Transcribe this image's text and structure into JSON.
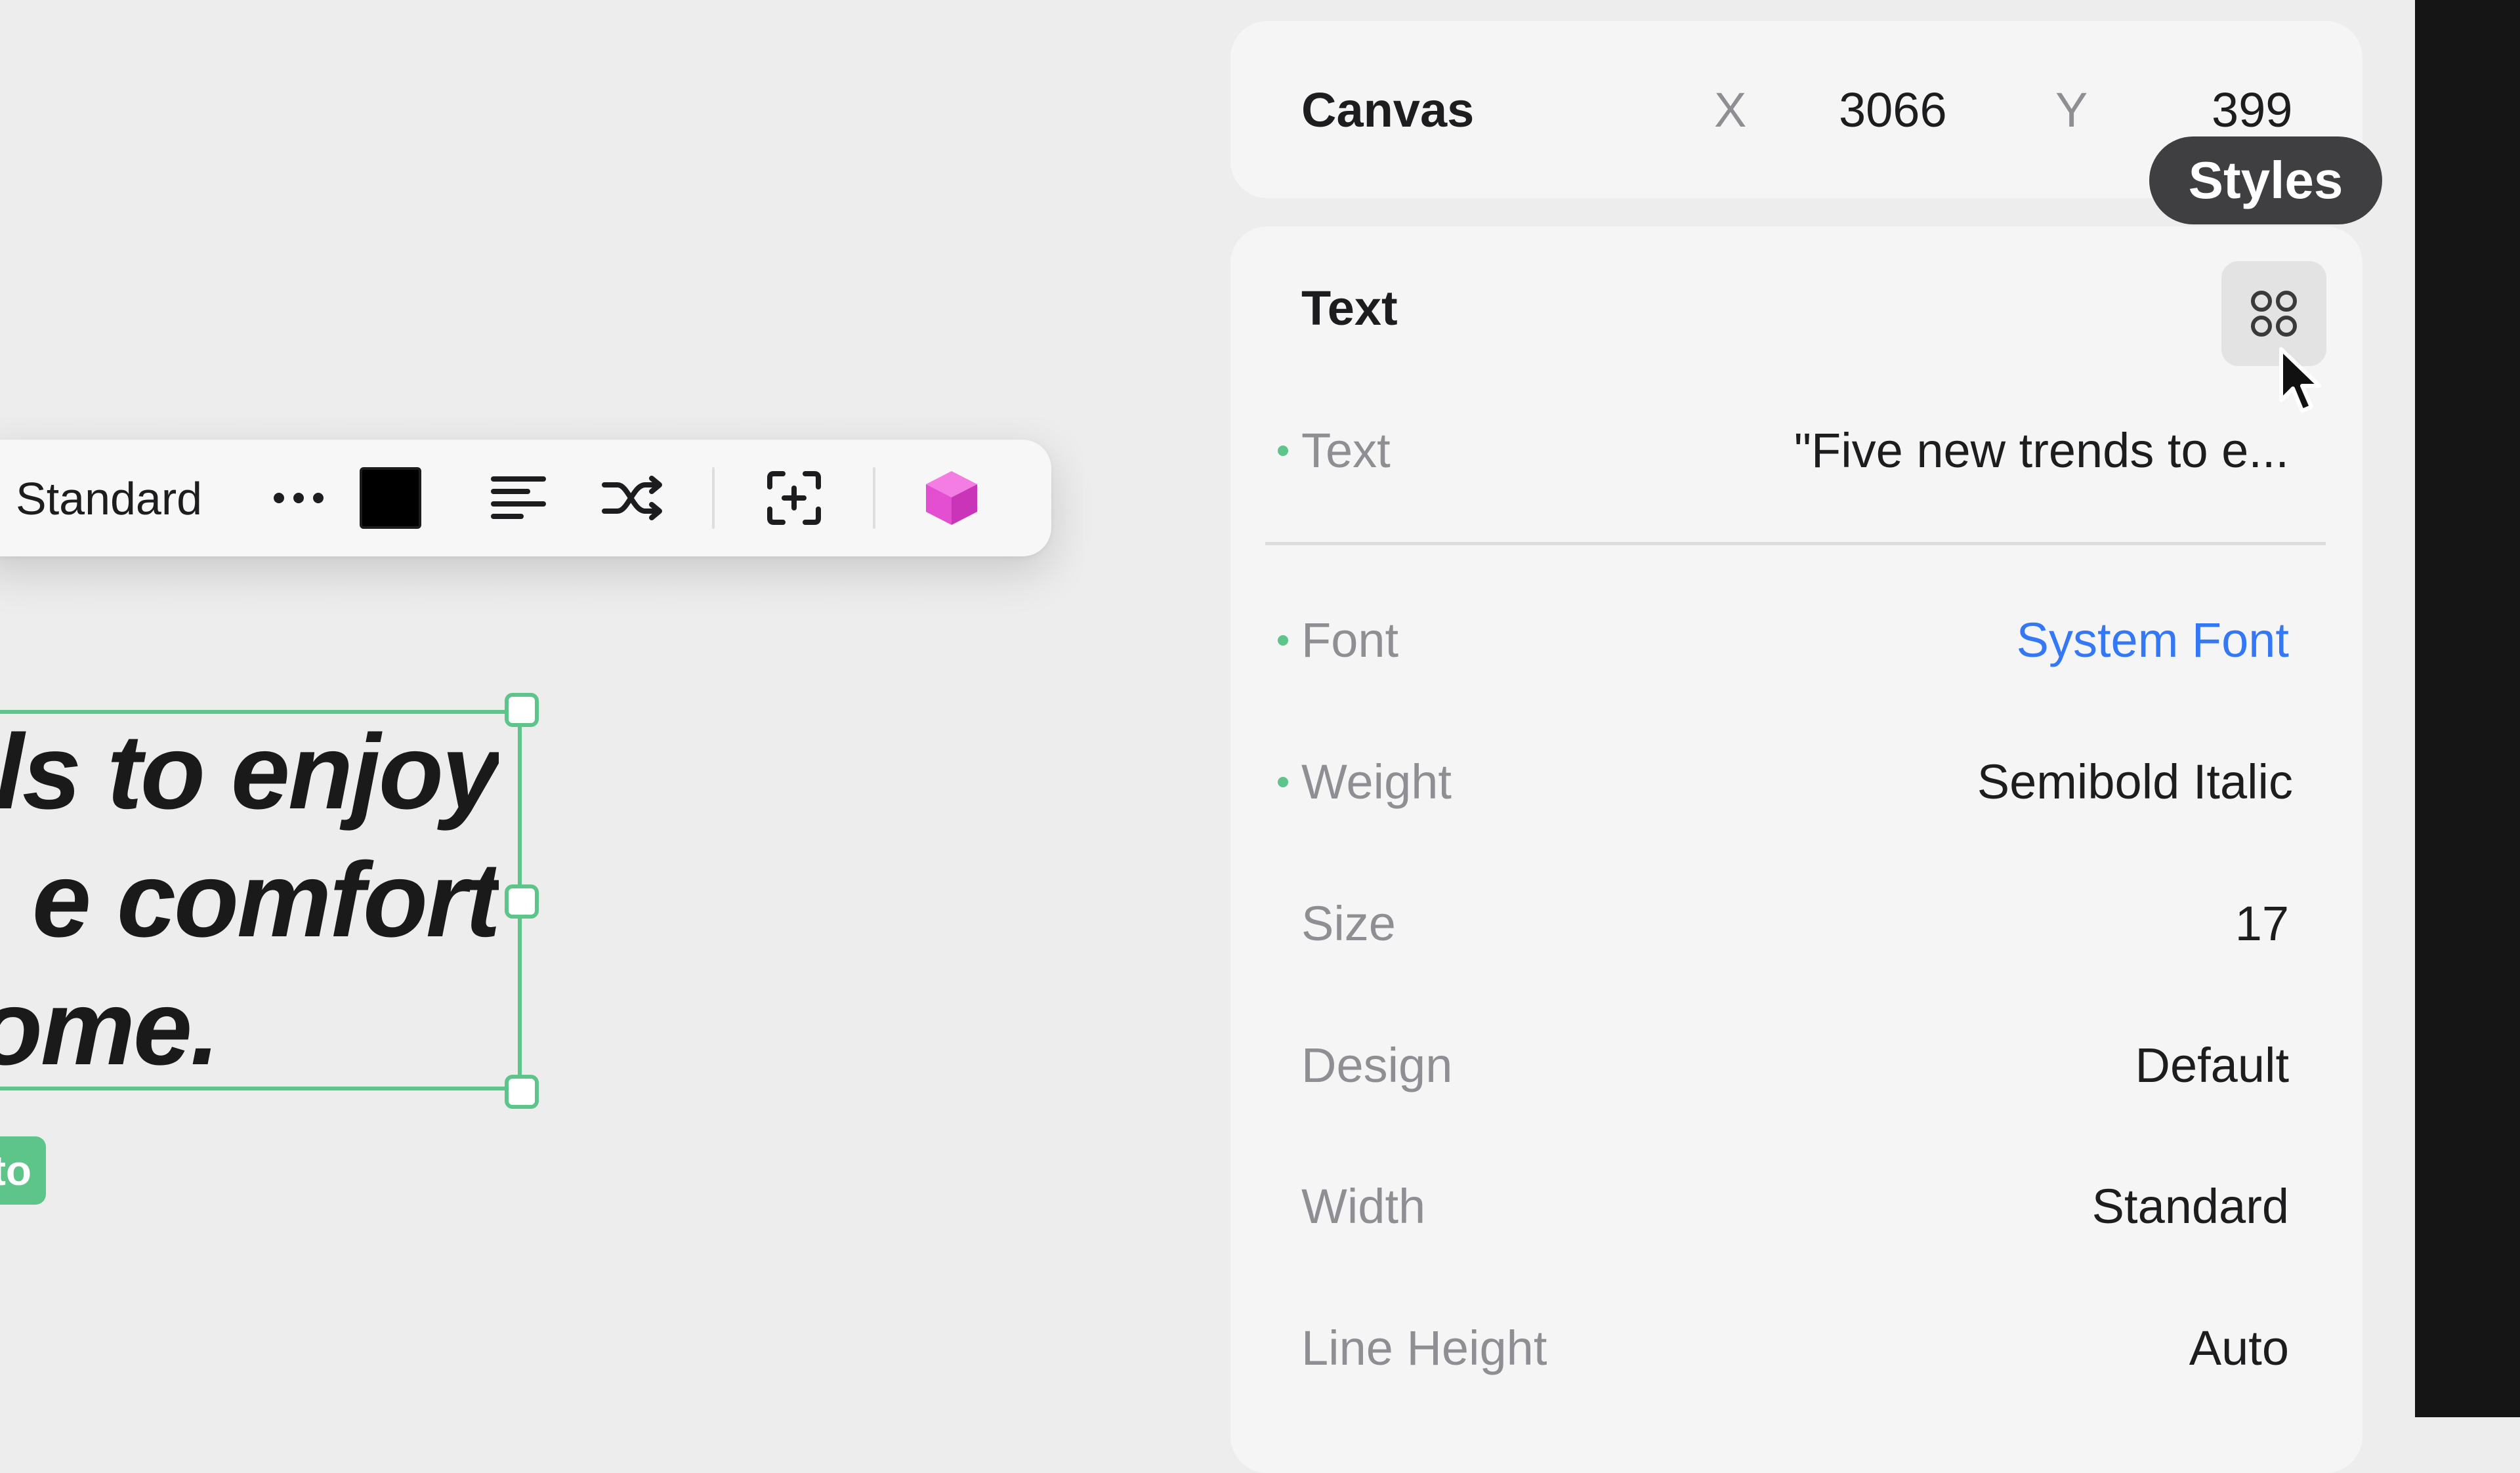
{
  "toolbar": {
    "width_label": "Standard",
    "more_icon": "ellipsis-icon",
    "text_color": "#000000",
    "align_icon": "text-align-left-icon",
    "shuffle_icon": "shuffle-icon",
    "focus_icon": "add-frame-icon",
    "component_icon": "cube-icon",
    "component_color": "#ec4fd6"
  },
  "canvas": {
    "text_lines": [
      "ls to enjoy",
      "e comfort",
      "ome."
    ],
    "selection_color": "#5ec58a",
    "chip_label": "to"
  },
  "inspector": {
    "position": {
      "title": "Canvas",
      "x_label": "X",
      "x_value": "3066",
      "y_label": "Y",
      "y_value": "399"
    },
    "styles_tooltip": "Styles",
    "styles_icon": "styles-grid-icon",
    "section_title": "Text",
    "rows": [
      {
        "label": "Text",
        "value": "\"Five new trends to e...",
        "modified": true
      },
      {
        "label": "Font",
        "value": "System Font",
        "modified": true,
        "link": true
      },
      {
        "label": "Weight",
        "value": "Semibold Italic",
        "modified": true
      },
      {
        "label": "Size",
        "value": "17",
        "modified": false
      },
      {
        "label": "Design",
        "value": "Default",
        "modified": false
      },
      {
        "label": "Width",
        "value": "Standard",
        "modified": false
      },
      {
        "label": "Line Height",
        "value": "Auto",
        "modified": false
      }
    ],
    "accent_color": "#3478f6",
    "modified_dot_color": "#5ec58a"
  }
}
